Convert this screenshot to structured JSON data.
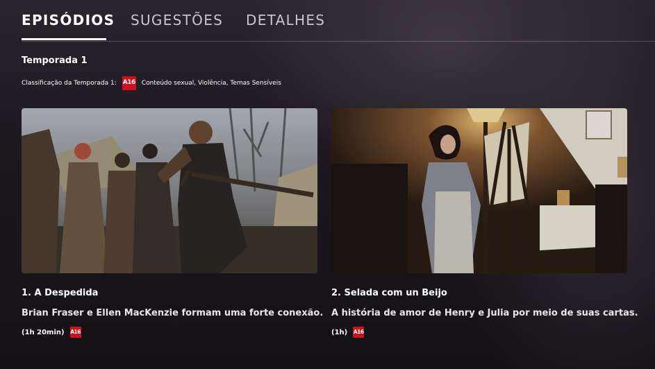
{
  "tabs": [
    {
      "label": "EPISÓDIOS",
      "active": true
    },
    {
      "label": "SUGESTÕES",
      "active": false
    },
    {
      "label": "DETALHES",
      "active": false
    }
  ],
  "season": {
    "title": "Temporada 1",
    "rating_label": "Classificação da Temporada 1:",
    "rating_badge": "A16",
    "rating_descriptors": "Conteúdo sexual, Violência, Temas Sensíveis"
  },
  "episodes": [
    {
      "title": "1. A Despedida",
      "description": "Brian Fraser e Ellen MacKenzie formam uma forte conexão.",
      "duration": "(1h 20min)",
      "badge": "A16",
      "thumbnail_icon": "battle-scene-image"
    },
    {
      "title": "2. Selada com un Beijo",
      "description": "A história de amor de Henry e Julia por meio de suas cartas.",
      "duration": "(1h)",
      "badge": "A16",
      "thumbnail_icon": "woman-painting-image"
    }
  ],
  "colors": {
    "rating_red": "#d0101a",
    "background": "#151217",
    "tab_inactive": "#c9c6cc"
  }
}
